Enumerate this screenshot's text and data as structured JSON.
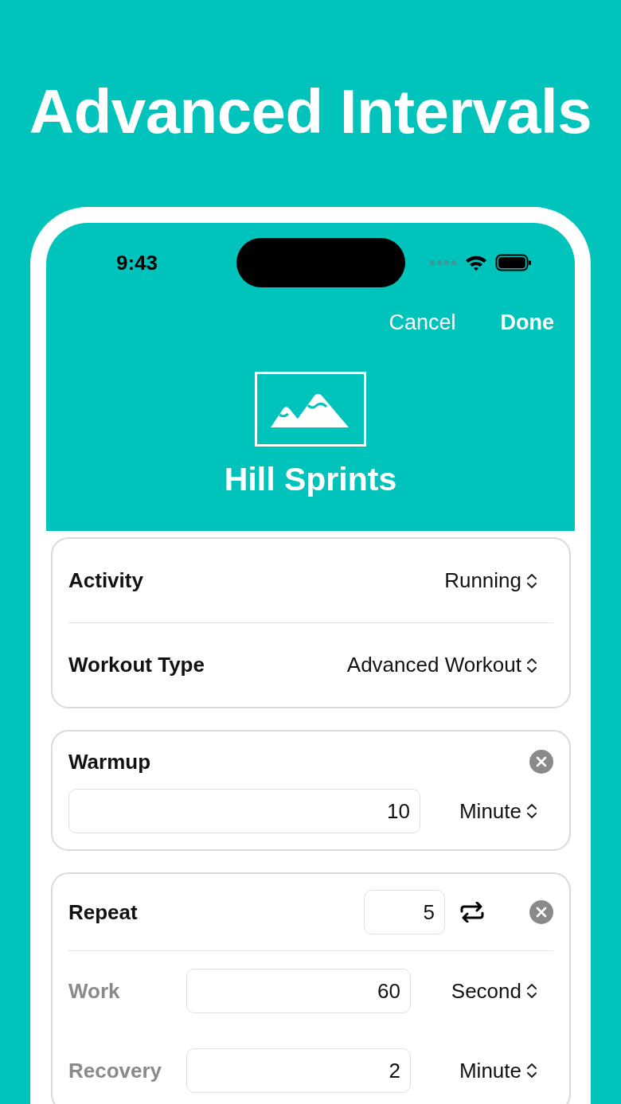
{
  "headline": "Advanced Intervals",
  "status_bar": {
    "time": "9:43"
  },
  "nav": {
    "cancel": "Cancel",
    "done": "Done"
  },
  "workout": {
    "title": "Hill Sprints"
  },
  "settings": [
    {
      "label": "Activity",
      "value": "Running"
    },
    {
      "label": "Workout Type",
      "value": "Advanced Workout"
    }
  ],
  "warmup": {
    "title": "Warmup",
    "value": "10",
    "unit": "Minute"
  },
  "repeat": {
    "title": "Repeat",
    "count": "5",
    "steps": [
      {
        "label": "Work",
        "value": "60",
        "unit": "Second"
      },
      {
        "label": "Recovery",
        "value": "2",
        "unit": "Minute"
      }
    ]
  }
}
